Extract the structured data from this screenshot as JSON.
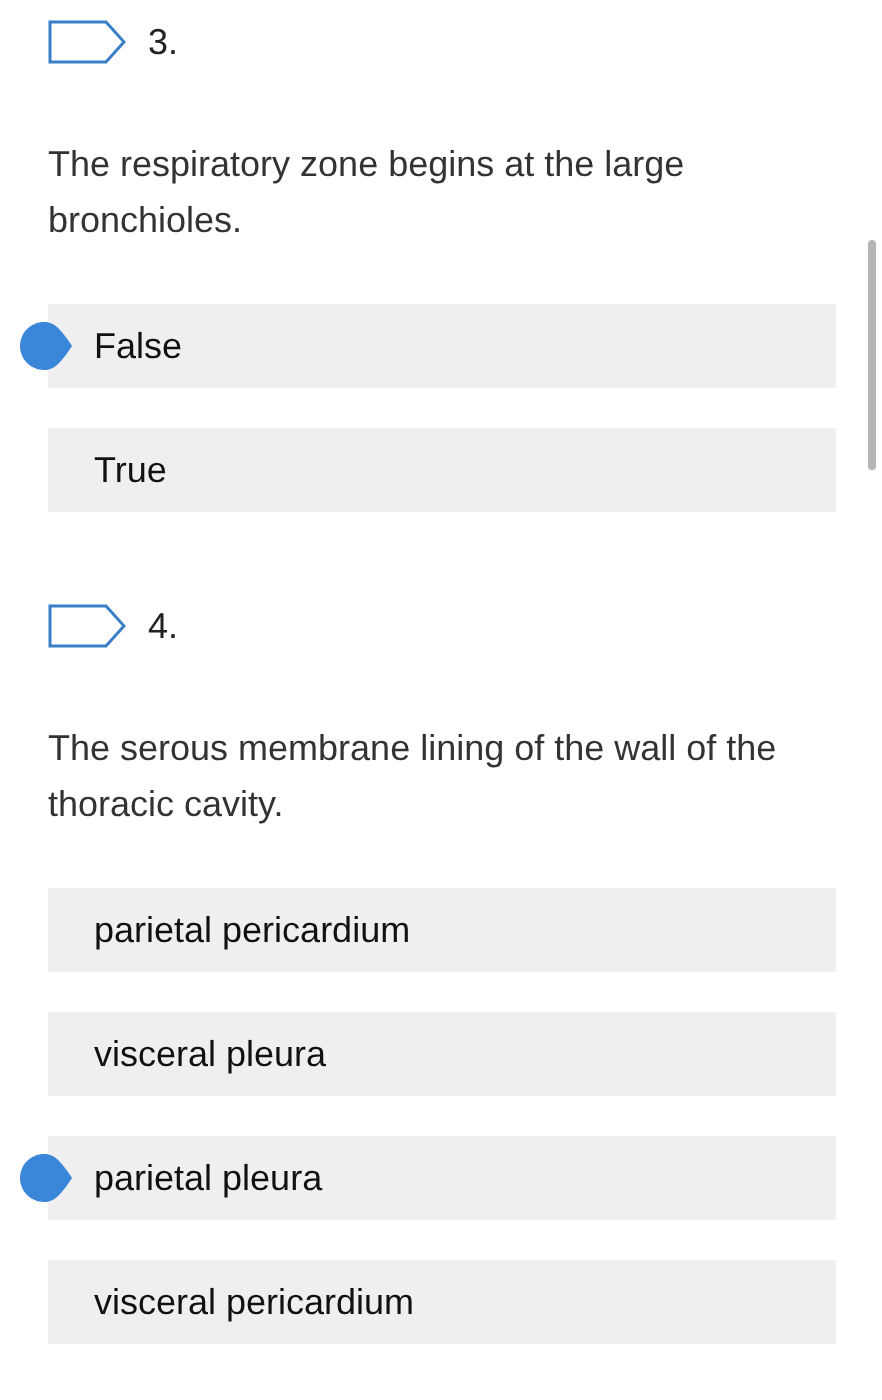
{
  "questions": [
    {
      "number": "3.",
      "text": "The respiratory zone begins at the large bronchioles.",
      "flagged": false,
      "options": [
        {
          "label": "False",
          "selected": true
        },
        {
          "label": "True",
          "selected": false
        }
      ]
    },
    {
      "number": "4.",
      "text": "The serous membrane lining of the wall of the thoracic cavity.",
      "flagged": false,
      "options": [
        {
          "label": "parietal pericardium",
          "selected": false
        },
        {
          "label": "visceral pleura",
          "selected": false
        },
        {
          "label": "parietal pleura",
          "selected": true
        },
        {
          "label": "visceral pericardium",
          "selected": false
        }
      ]
    }
  ]
}
